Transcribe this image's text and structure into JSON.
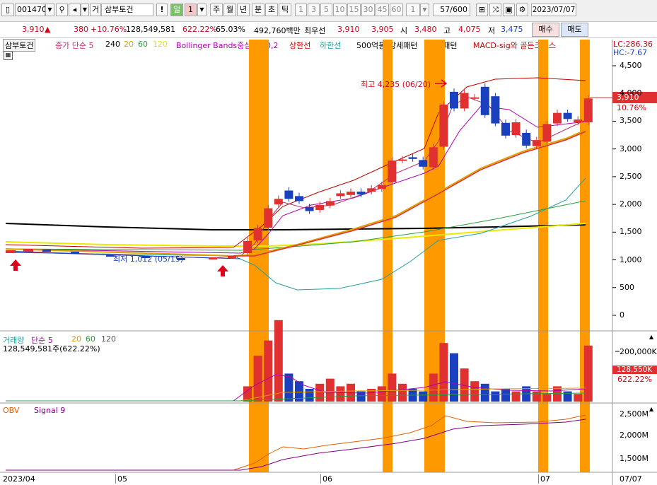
{
  "toolbar": {
    "code": "001470",
    "mode": "거",
    "name": "삼부토건",
    "alert": "!",
    "period": "일",
    "count": "1",
    "period_tabs": [
      "주",
      "월",
      "년",
      "분",
      "초",
      "틱"
    ],
    "minute_tabs": [
      "1",
      "3",
      "5",
      "10",
      "15",
      "30",
      "45",
      "60"
    ],
    "unit": "1",
    "page": "57/600",
    "date": "2023/07/07"
  },
  "quote": {
    "price": "3,910",
    "change": "380",
    "rate": "+10.76%",
    "volume": "128,549,581",
    "vol_ratio": "622.22%",
    "turnover": "65.03%",
    "amount": "492,760백만",
    "bid_label": "최우선",
    "bid1": "3,910",
    "bid2": "3,905",
    "open_label": "시",
    "open": "3,480",
    "high_label": "고",
    "high": "4,075",
    "low_label": "저",
    "low": "3,475",
    "buy_btn": "매수",
    "sell_btn": "매도"
  },
  "price_panel": {
    "tab": "삼부토건",
    "legend": [
      {
        "text": "종가 단순 5",
        "color": "#c0306a"
      },
      {
        "text": "240",
        "color": "#000000"
      },
      {
        "text": "20",
        "color": "#e0a000"
      },
      {
        "text": "60",
        "color": "#2a9d3a"
      },
      {
        "text": "120",
        "color": "#e8e000"
      },
      {
        "text": "Bollinger Bands중심선 20,2",
        "color": "#b000b0"
      },
      {
        "text": "상한선",
        "color": "#c00000"
      },
      {
        "text": "하한선",
        "color": "#20a0a0"
      },
      {
        "text": "500억봉",
        "color": "#000000"
      },
      {
        "text": "강세패턴",
        "color": "#000000"
      },
      {
        "text": "약세패턴",
        "color": "#000000"
      },
      {
        "text": "MACD-sig와 골든크로스",
        "color": "#c00000"
      }
    ],
    "lc": "LC:286.36",
    "hc": "HC:-7.67",
    "high_note": "최고 4,235 (06/20)",
    "low_note": "최저 1,012 (05/15)",
    "last_price": "3,910",
    "last_rate": "10.76%",
    "y_labels": [
      "4,500",
      "4,000",
      "3,500",
      "3,000",
      "2,500",
      "2,000",
      "1,500",
      "1,000",
      "500",
      "0"
    ]
  },
  "volume_panel": {
    "legend": [
      {
        "text": "거래량",
        "color": "#20a0a0"
      },
      {
        "text": "단순 5",
        "color": "#b000b0"
      },
      {
        "text": "20",
        "color": "#e0a000"
      },
      {
        "text": "60",
        "color": "#2a9d3a"
      },
      {
        "text": "120",
        "color": "#555555"
      }
    ],
    "info": "128,549,581주(622.22%)",
    "y_label": "200,000K",
    "last_vol": "128,550K",
    "last_rate": "622.22%"
  },
  "obv_panel": {
    "legend": [
      {
        "text": "OBV",
        "color": "#e06000"
      },
      {
        "text": "Signal 9",
        "color": "#800080"
      }
    ],
    "y_labels": [
      "2,500M",
      "2,000M",
      "1,500M"
    ]
  },
  "xaxis": {
    "labels": [
      "2023/04",
      "05",
      "06",
      "07"
    ],
    "end": "07/07"
  },
  "chart_data": {
    "type": "candlestick",
    "period_range": [
      "2023/04",
      "2023/07/07"
    ],
    "candles_after_breakout": [
      {
        "o": 1120,
        "c": 1340,
        "up": true
      },
      {
        "o": 1350,
        "c": 1570,
        "up": true
      },
      {
        "o": 1580,
        "c": 1930,
        "up": true
      },
      {
        "o": 2000,
        "c": 2100,
        "up": true
      },
      {
        "o": 2250,
        "c": 2100,
        "up": false
      },
      {
        "o": 2150,
        "c": 2060,
        "up": false
      },
      {
        "o": 1950,
        "c": 1880,
        "up": false
      },
      {
        "o": 1900,
        "c": 1990,
        "up": true
      },
      {
        "o": 1980,
        "c": 2060,
        "up": true
      },
      {
        "o": 2150,
        "c": 2200,
        "up": true
      },
      {
        "o": 2170,
        "c": 2230,
        "up": true
      },
      {
        "o": 2230,
        "c": 2180,
        "up": false
      },
      {
        "o": 2230,
        "c": 2290,
        "up": true
      },
      {
        "o": 2280,
        "c": 2350,
        "up": true
      },
      {
        "o": 2400,
        "c": 2790,
        "up": true
      },
      {
        "o": 2790,
        "c": 2810,
        "up": true
      },
      {
        "o": 2850,
        "c": 2820,
        "up": false
      },
      {
        "o": 2800,
        "c": 2680,
        "up": false
      },
      {
        "o": 2670,
        "c": 3030,
        "up": true
      },
      {
        "o": 3040,
        "c": 3800,
        "up": true
      },
      {
        "o": 4030,
        "c": 3730,
        "up": false
      },
      {
        "o": 3730,
        "c": 4010,
        "up": true
      },
      {
        "o": 3920,
        "c": 3930,
        "up": true
      },
      {
        "o": 4120,
        "c": 3610,
        "up": false
      },
      {
        "o": 3950,
        "c": 3460,
        "up": false
      },
      {
        "o": 3470,
        "c": 3240,
        "up": false
      },
      {
        "o": 3250,
        "c": 3480,
        "up": true
      },
      {
        "o": 3290,
        "c": 3060,
        "up": false
      },
      {
        "o": 3050,
        "c": 3160,
        "up": true
      },
      {
        "o": 3130,
        "c": 3450,
        "up": true
      },
      {
        "o": 3460,
        "c": 3650,
        "up": true
      },
      {
        "o": 3650,
        "c": 3540,
        "up": false
      },
      {
        "o": 3480,
        "c": 3530,
        "up": true
      },
      {
        "o": 3480,
        "c": 3910,
        "up": true
      }
    ],
    "y_range": [
      0,
      4500
    ],
    "volume_ticks": [
      "200,000K"
    ],
    "obv_ticks": [
      "2,500M",
      "2,000M",
      "1,500M"
    ]
  }
}
